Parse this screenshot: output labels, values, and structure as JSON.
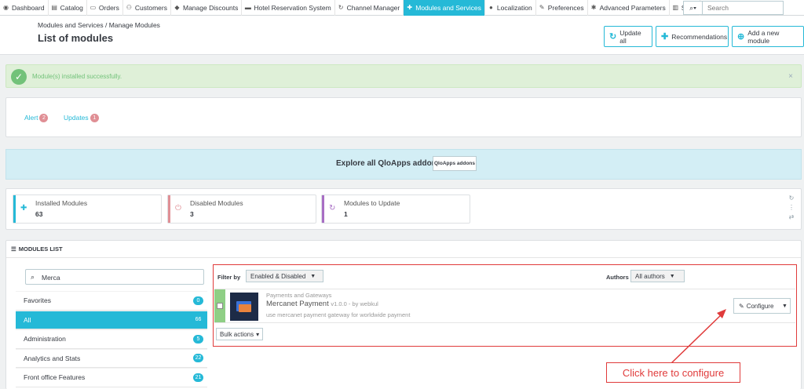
{
  "nav": {
    "items": [
      {
        "icon": "dashboard-icon",
        "glyph": "◉",
        "label": "Dashboard"
      },
      {
        "icon": "catalog-icon",
        "glyph": "▤",
        "label": "Catalog"
      },
      {
        "icon": "orders-icon",
        "glyph": "▭",
        "label": "Orders"
      },
      {
        "icon": "customers-icon",
        "glyph": "⚇",
        "label": "Customers"
      },
      {
        "icon": "tag-icon",
        "glyph": "◆",
        "label": "Manage Discounts"
      },
      {
        "icon": "bed-icon",
        "glyph": "▬",
        "label": "Hotel Reservation System"
      },
      {
        "icon": "refresh-icon",
        "glyph": "↻",
        "label": "Channel Manager"
      },
      {
        "icon": "puzzle-icon",
        "glyph": "✚",
        "label": "Modules and Services"
      },
      {
        "icon": "globe-icon",
        "glyph": "●",
        "label": "Localization"
      },
      {
        "icon": "wrench-icon",
        "glyph": "✎",
        "label": "Preferences"
      },
      {
        "icon": "cogs-icon",
        "glyph": "✱",
        "label": "Advanced Parameters"
      },
      {
        "icon": "bar-chart-icon",
        "glyph": "▥",
        "label": "Stats"
      }
    ],
    "active_index": 7,
    "search_placeholder": "Search"
  },
  "header": {
    "breadcrumb": "Modules and Services  /  Manage Modules",
    "title": "List of modules",
    "buttons": {
      "update_all": "Update all",
      "recommendations": "Recommendations",
      "add_module": "Add a new module"
    }
  },
  "alert": {
    "message": "Module(s) installed successfully.",
    "close": "×"
  },
  "tabs": {
    "alert_label": "Alert",
    "alert_count": "2",
    "updates_label": "Updates",
    "updates_count": "1"
  },
  "addons": {
    "text": "Explore all QloApps addons",
    "button": "QloApps addons"
  },
  "stats": [
    {
      "label": "Installed Modules",
      "value": "63",
      "color": "#25b9d7",
      "icon": "puzzle-icon"
    },
    {
      "label": "Disabled Modules",
      "value": "3",
      "color": "#e08f95",
      "icon": "power-icon"
    },
    {
      "label": "Modules to Update",
      "value": "1",
      "color": "#a86ec4",
      "icon": "refresh-icon"
    }
  ],
  "modules_list": {
    "title": "MODULES LIST",
    "search_value": "Merca",
    "categories": [
      {
        "label": "Favorites",
        "count": "0"
      },
      {
        "label": "All",
        "count": "66"
      },
      {
        "label": "Administration",
        "count": "5"
      },
      {
        "label": "Analytics and Stats",
        "count": "22"
      },
      {
        "label": "Front office Features",
        "count": "21"
      }
    ],
    "active_category": 1,
    "filter_by_label": "Filter by",
    "filter_by_value": "Enabled & Disabled",
    "authors_label": "Authors",
    "authors_value": "All authors",
    "module": {
      "category": "Payments and Gateways",
      "name": "Mercanet Payment",
      "version": "v1.0.0 - by webkul",
      "description": "use mercanet payment gateway for worldwide payment",
      "configure_label": "Configure"
    },
    "bulk_actions": "Bulk actions"
  },
  "annotation": {
    "text": "Click here to configure",
    "color": "#e03b3b"
  }
}
